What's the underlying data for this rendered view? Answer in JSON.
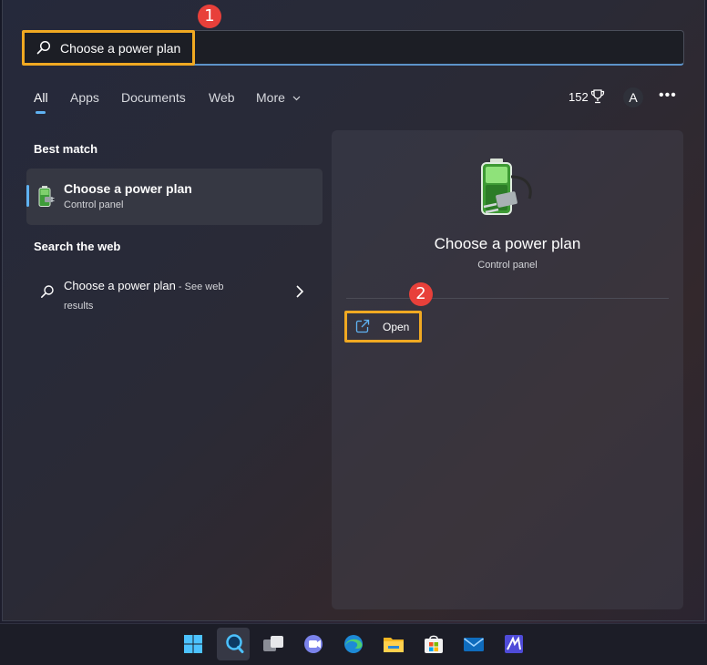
{
  "search": {
    "value": "Choose a power plan",
    "placeholder": ""
  },
  "annotations": [
    "1",
    "2"
  ],
  "tabs": [
    {
      "label": "All",
      "active": true
    },
    {
      "label": "Apps"
    },
    {
      "label": "Documents"
    },
    {
      "label": "Web"
    },
    {
      "label": "More"
    }
  ],
  "header_right": {
    "points": "152",
    "avatar_initial": "A",
    "more_icon": "ellipsis-icon"
  },
  "best_match": {
    "section_label": "Best match",
    "title": "Choose a power plan",
    "subtitle": "Control panel",
    "icon": "battery-plug-icon"
  },
  "search_web": {
    "section_label": "Search the web",
    "query": "Choose a power plan",
    "suffix": " - See web results"
  },
  "preview": {
    "title": "Choose a power plan",
    "subtitle": "Control panel",
    "actions": [
      {
        "label": "Open",
        "icon": "open-external-icon"
      }
    ]
  },
  "taskbar": {
    "items": [
      "windows-start-icon",
      "search-icon",
      "task-view-icon",
      "teams-chat-icon",
      "edge-browser-icon",
      "file-explorer-icon",
      "microsoft-store-icon",
      "mail-icon",
      "app-icon"
    ]
  },
  "colors": {
    "accent": "#5fb2f2",
    "highlight": "#f0a922",
    "badge": "#e8403a"
  }
}
